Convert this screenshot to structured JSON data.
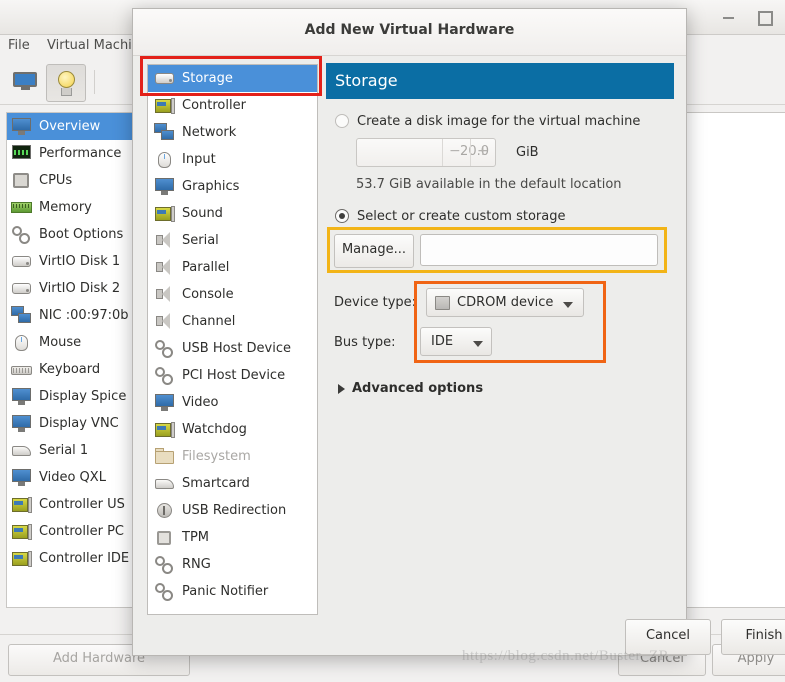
{
  "background_window": {
    "title": "",
    "window_controls": {
      "minimize": "_",
      "maximize": "□"
    },
    "menus": [
      {
        "label": "File",
        "name": "menu-file"
      },
      {
        "label": "Virtual Machine",
        "name": "menu-virtual-machine"
      }
    ],
    "toolbar": [
      {
        "name": "console-view-icon",
        "icon": "monitor-icon"
      },
      {
        "name": "show-details-icon",
        "icon": "lightbulb-icon",
        "pressed": true
      },
      {
        "name": "run-vm-icon",
        "icon": "play-icon",
        "disabled": true
      }
    ],
    "hardware_list": [
      {
        "label": "Overview",
        "icon": "monitor-icon",
        "selected": true
      },
      {
        "label": "Performance",
        "icon": "performance-graph-icon"
      },
      {
        "label": "CPUs",
        "icon": "cpu-chip-icon"
      },
      {
        "label": "Memory",
        "icon": "memory-module-icon"
      },
      {
        "label": "Boot Options",
        "icon": "gears-icon"
      },
      {
        "label": "VirtIO Disk 1",
        "icon": "disk-icon"
      },
      {
        "label": "VirtIO Disk 2",
        "icon": "disk-icon"
      },
      {
        "label": "NIC :00:97:0b",
        "icon": "network-icon"
      },
      {
        "label": "Mouse",
        "icon": "mouse-icon"
      },
      {
        "label": "Keyboard",
        "icon": "keyboard-icon"
      },
      {
        "label": "Display Spice",
        "icon": "monitor-icon"
      },
      {
        "label": "Display VNC",
        "icon": "monitor-icon"
      },
      {
        "label": "Serial 1",
        "icon": "serial-icon"
      },
      {
        "label": "Video QXL",
        "icon": "monitor-icon"
      },
      {
        "label": "Controller US",
        "icon": "controller-card-icon"
      },
      {
        "label": "Controller PC",
        "icon": "controller-card-icon"
      },
      {
        "label": "Controller IDE",
        "icon": "controller-card-icon"
      }
    ],
    "buttons": {
      "add_hardware": "Add Hardware",
      "cancel": "Cancel",
      "apply": "Apply"
    }
  },
  "dialog": {
    "title": "Add New Virtual Hardware",
    "device_list": [
      {
        "label": "Storage",
        "icon": "storage-icon",
        "selected": true
      },
      {
        "label": "Controller",
        "icon": "controller-card-icon"
      },
      {
        "label": "Network",
        "icon": "network-icon"
      },
      {
        "label": "Input",
        "icon": "mouse-icon"
      },
      {
        "label": "Graphics",
        "icon": "monitor-icon"
      },
      {
        "label": "Sound",
        "icon": "sound-card-icon"
      },
      {
        "label": "Serial",
        "icon": "speaker-port-icon"
      },
      {
        "label": "Parallel",
        "icon": "speaker-port-icon"
      },
      {
        "label": "Console",
        "icon": "speaker-port-icon"
      },
      {
        "label": "Channel",
        "icon": "speaker-port-icon"
      },
      {
        "label": "USB Host Device",
        "icon": "gears-icon"
      },
      {
        "label": "PCI Host Device",
        "icon": "gears-icon"
      },
      {
        "label": "Video",
        "icon": "monitor-icon"
      },
      {
        "label": "Watchdog",
        "icon": "controller-card-icon"
      },
      {
        "label": "Filesystem",
        "icon": "folder-icon",
        "disabled": true
      },
      {
        "label": "Smartcard",
        "icon": "smartcard-icon"
      },
      {
        "label": "USB Redirection",
        "icon": "usb-icon"
      },
      {
        "label": "TPM",
        "icon": "tpm-chip-icon"
      },
      {
        "label": "RNG",
        "icon": "gears-icon"
      },
      {
        "label": "Panic Notifier",
        "icon": "gears-icon"
      }
    ],
    "panel": {
      "header": "Storage",
      "create_disk_option": "Create a disk image for the virtual machine",
      "create_disk_selected": false,
      "size_value": "20.0",
      "size_unit": "GiB",
      "spinner_minus": "−",
      "spinner_plus": "+",
      "available_note": "53.7 GiB available in the default location",
      "custom_storage_option": "Select or create custom storage",
      "custom_storage_selected": true,
      "manage_button": "Manage...",
      "path_value": "",
      "path_placeholder": "",
      "device_type_label": "Device type:",
      "device_type_value": "CDROM device",
      "bus_type_label": "Bus type:",
      "bus_type_value": "IDE",
      "advanced_options": "Advanced options"
    },
    "buttons": {
      "cancel": "Cancel",
      "finish": "Finish"
    }
  },
  "highlights": {
    "red": "#e32119",
    "yellow": "#f2b417",
    "orange": "#f06414"
  },
  "watermark": "https://blog.csdn.net/Buster_ZR"
}
